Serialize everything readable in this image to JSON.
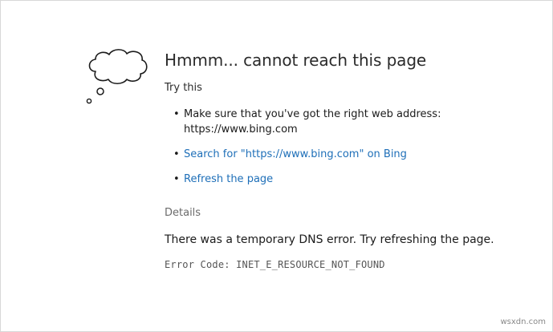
{
  "error_page": {
    "title": "Hmmm... cannot reach this page",
    "try_this": "Try this",
    "suggestions": [
      {
        "text": "Make sure that you've got the right web address: https://www.bing.com"
      },
      {
        "text": "Search for \"https://www.bing.com\" on Bing"
      },
      {
        "text": "Refresh the page"
      }
    ],
    "bullet": "•",
    "details_heading": "Details",
    "details_text": "There was a temporary DNS error. Try refreshing the page.",
    "error_code": "Error Code: INET_E_RESOURCE_NOT_FOUND",
    "icon": "thought-cloud-icon",
    "link_color": "#1e6fb8"
  },
  "watermark": {
    "text": "wsxdn.com"
  }
}
